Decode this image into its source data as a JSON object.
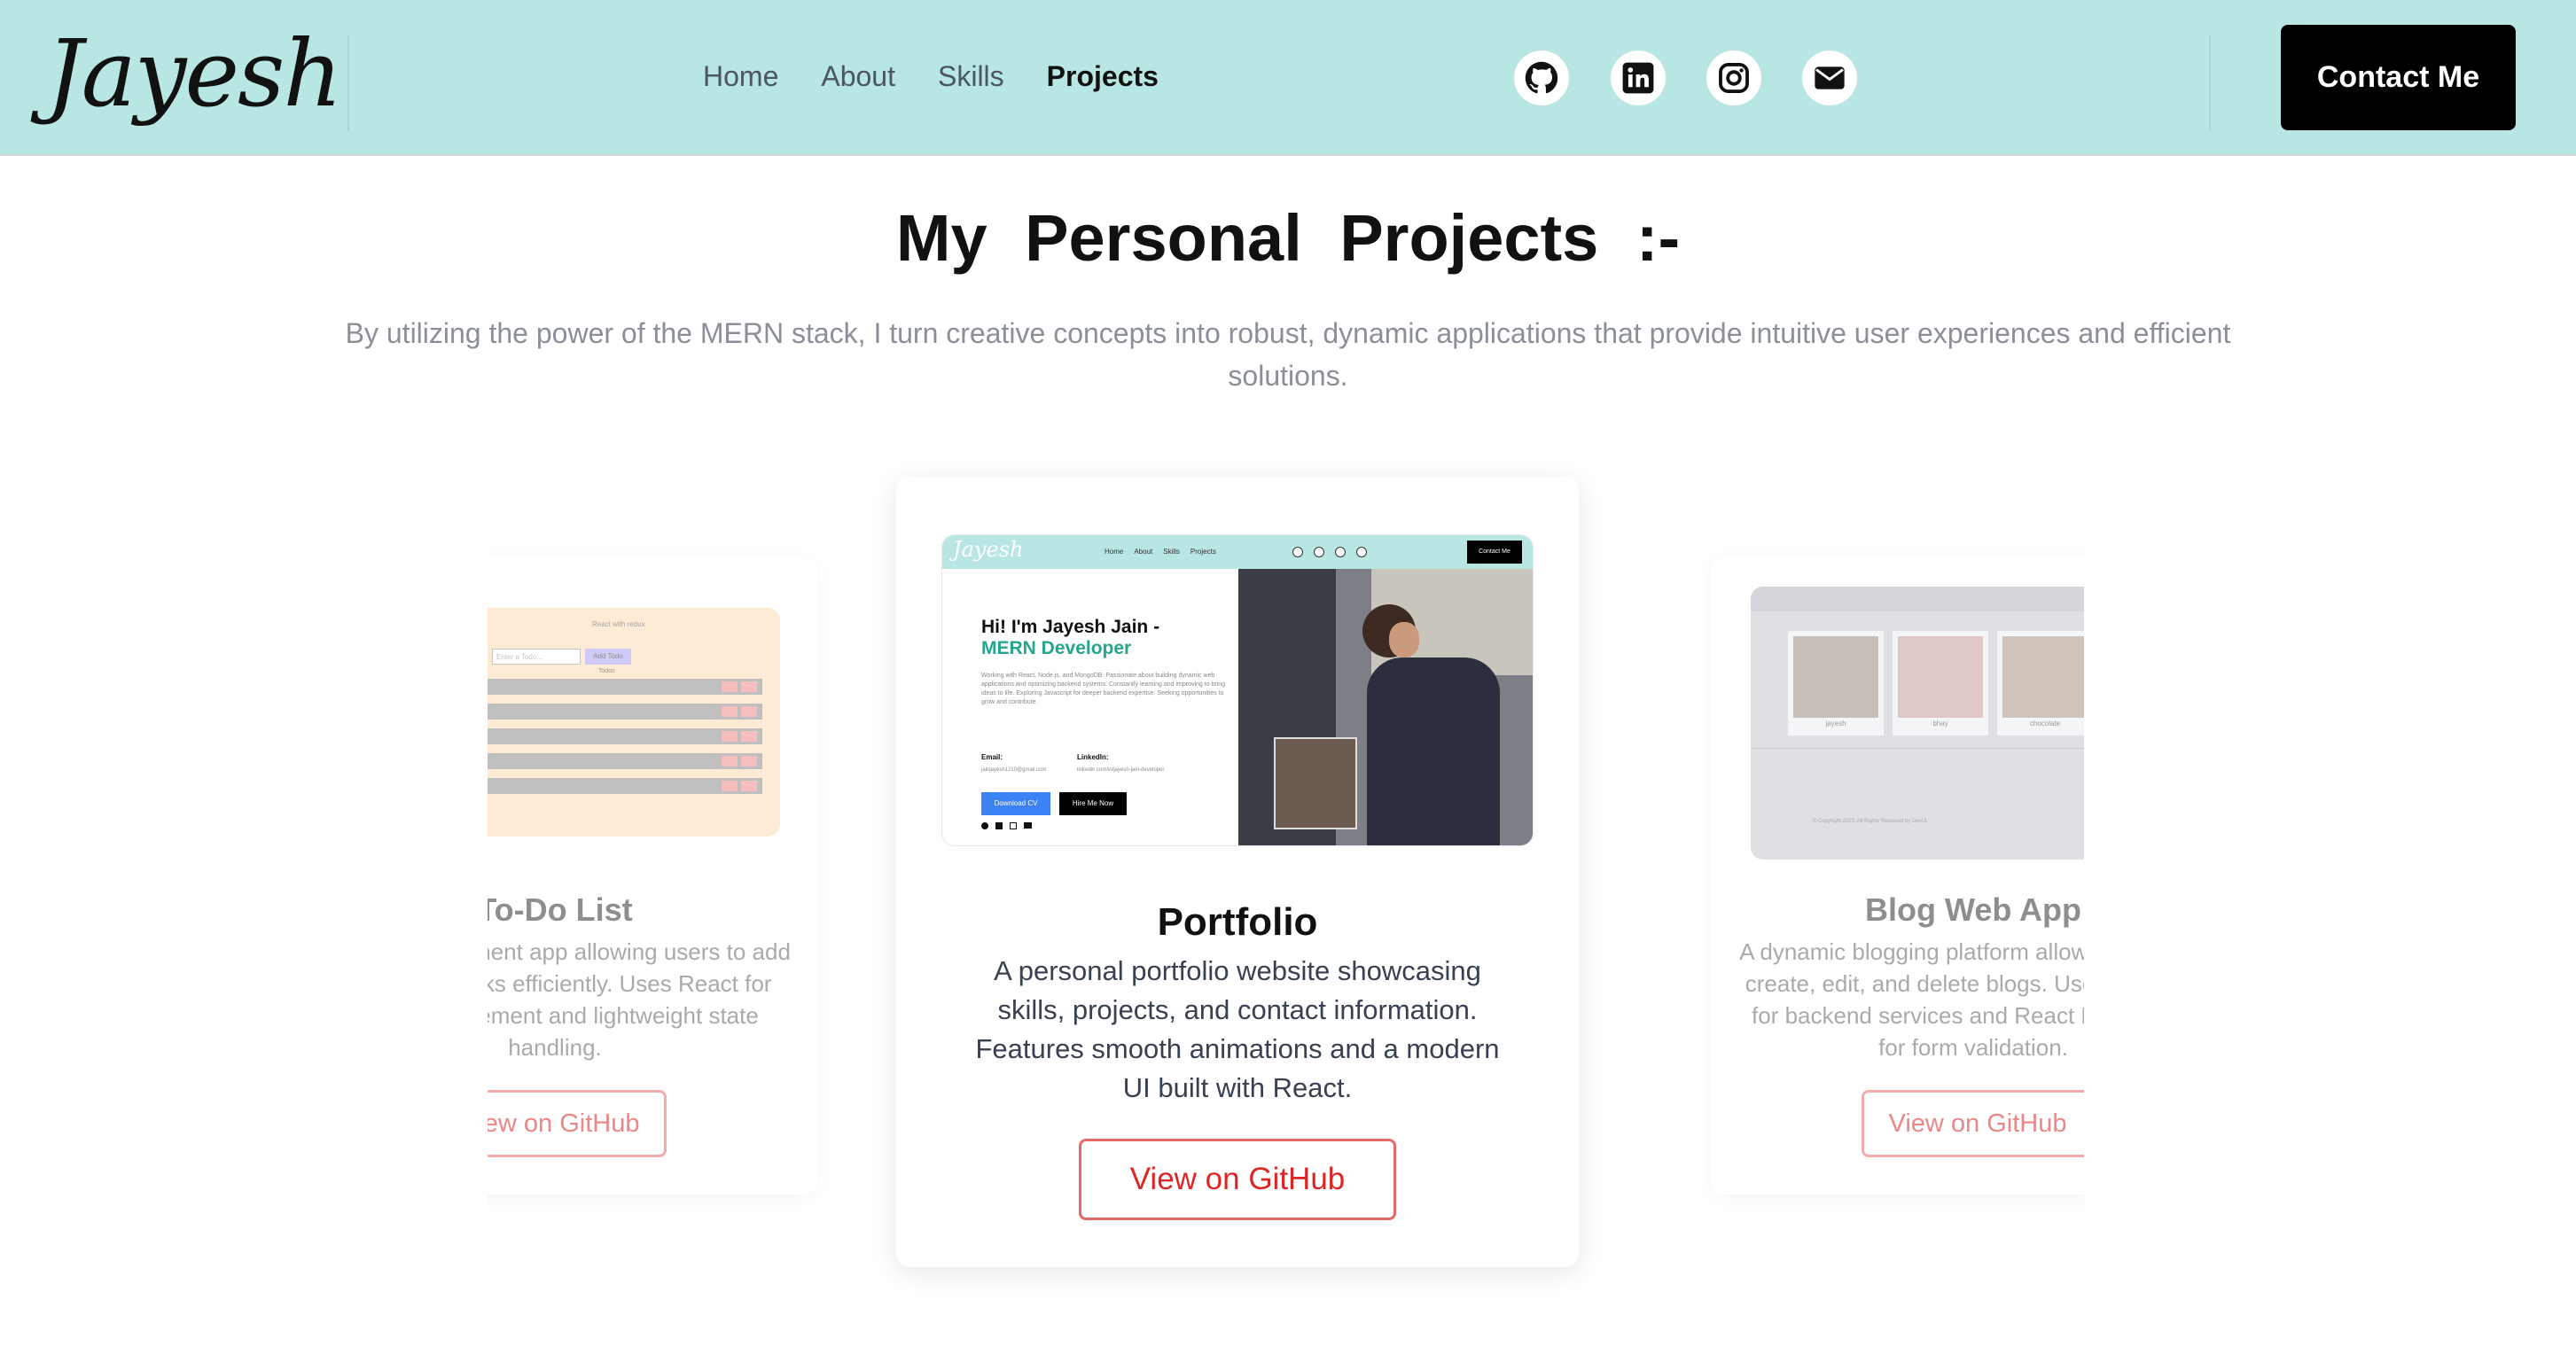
{
  "nav": {
    "logo": "Jayesh",
    "links": [
      "Home",
      "About",
      "Skills",
      "Projects"
    ],
    "active": "Projects",
    "socials": [
      "github-icon",
      "linkedin-icon",
      "instagram-icon",
      "email-icon"
    ],
    "contact_label": "Contact Me"
  },
  "section": {
    "title": "My Personal Projects :-",
    "subtitle": "By utilizing the power of the MERN stack, I turn creative concepts into robust, dynamic applications that provide intuitive user experiences and efficient solutions."
  },
  "projects": [
    {
      "title": "To-Do List",
      "description": "A task management app allowing users to add and delete tasks efficiently. Uses React for state management and lightweight state handling.",
      "button": "View on GitHub",
      "thumb": {
        "heading": "React with redux",
        "input_placeholder": "Enter a Todo...",
        "add_button": "Add Todo",
        "list_label": "Todos"
      }
    },
    {
      "title": "Portfolio",
      "description": "A personal portfolio website showcasing skills, projects, and contact information. Features smooth animations and a modern UI built with React.",
      "button": "View on GitHub",
      "thumb": {
        "logo": "Jayesh",
        "links": [
          "Home",
          "About",
          "Skills",
          "Projects"
        ],
        "contact": "Contact Me",
        "greeting": "Hi! I'm Jayesh Jain -",
        "role": "MERN Developer",
        "bio": "Working with React, Node.js, and MongoDB. Passionate about building dynamic web applications and optimizing backend systems. Constantly learning and improving to bring ideas to life. Exploring Javascript for deeper backend expertise. Seeking opportunities to grow and contribute.",
        "email_label": "Email:",
        "email": "jainjayesh1210@gmail.com",
        "linkedin_label": "LinkedIn:",
        "linkedin": "linkedin.com/in/jayesh-jain-developer",
        "download_cv": "Download CV",
        "hire": "Hire Me Now"
      }
    },
    {
      "title": "Blog Web App",
      "description": "A dynamic blogging platform allowing users to create, edit, and delete blogs. Uses Appwrite for backend services and React Hook Form for form validation.",
      "button": "View on GitHub",
      "thumb": {
        "post_captions": [
          "jayesh",
          "bhay",
          "chocolate"
        ],
        "footer_copyright": "© Copyright 2023. All Rights Reserved by DevUI."
      }
    }
  ],
  "colors": {
    "nav_bg": "#b8e6e3",
    "button_border": "#e46a6a",
    "button_text": "#dc2626",
    "role_teal": "#27a58d",
    "todo_bg": "#fddcb5"
  }
}
